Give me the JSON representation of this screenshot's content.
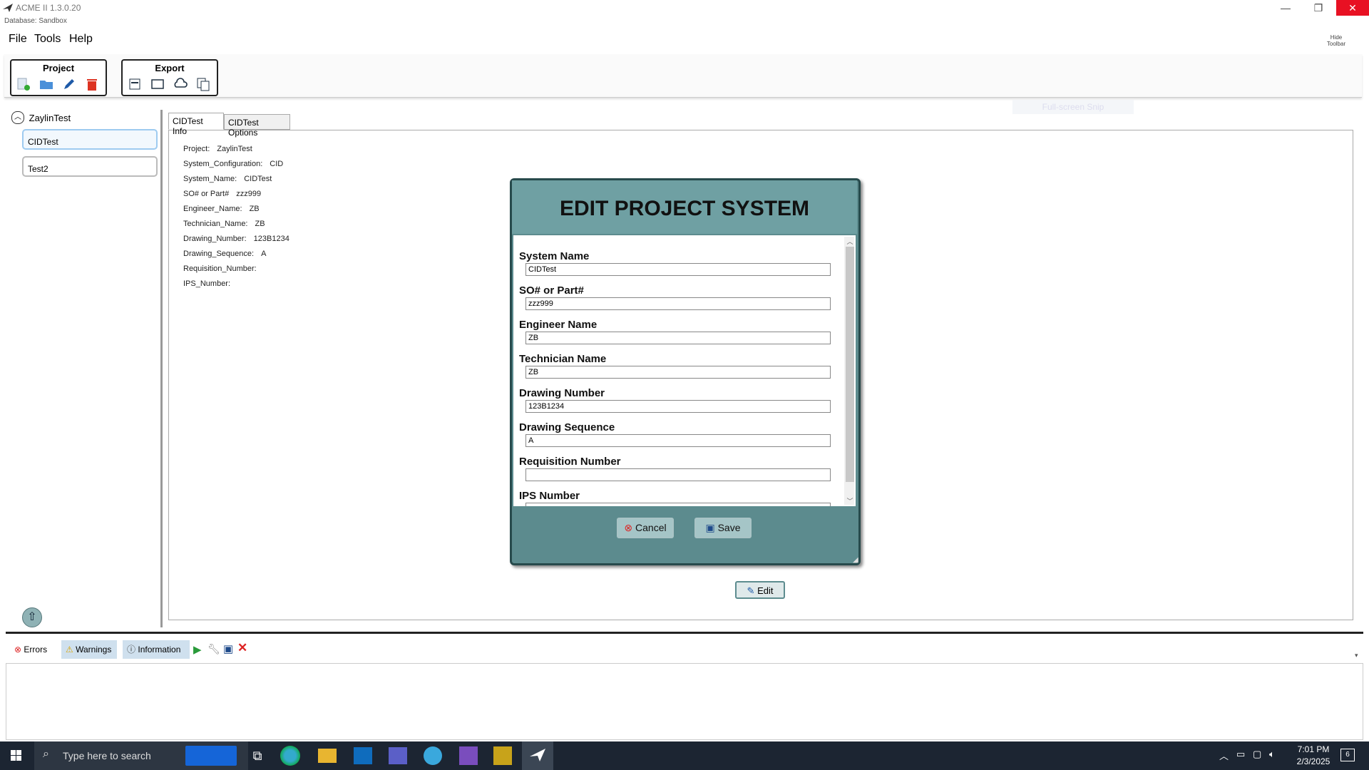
{
  "window": {
    "title": "ACME II 1.3.0.20",
    "database_label": "Database: Sandbox",
    "minimize": "—",
    "restore": "❐",
    "close": "✕"
  },
  "menu": {
    "file": "File",
    "tools": "Tools",
    "help": "Help",
    "hide_toolbar": "Hide Toolbar"
  },
  "toolbar": {
    "project_group": "Project",
    "export_group": "Export"
  },
  "tree": {
    "root": "ZaylinTest",
    "items": [
      "CIDTest",
      "Test2"
    ]
  },
  "tabs": {
    "info": "CIDTest Info",
    "options": "CIDTest Options"
  },
  "info": [
    {
      "label": "Project:",
      "value": "ZaylinTest"
    },
    {
      "label": "System_Configuration:",
      "value": "CID"
    },
    {
      "label": "System_Name:",
      "value": "CIDTest"
    },
    {
      "label": "SO# or Part#",
      "value": "zzz999"
    },
    {
      "label": "Engineer_Name:",
      "value": "ZB"
    },
    {
      "label": "Technician_Name:",
      "value": "ZB"
    },
    {
      "label": "Drawing_Number:",
      "value": "123B1234"
    },
    {
      "label": "Drawing_Sequence:",
      "value": "A"
    },
    {
      "label": "Requisition_Number:",
      "value": ""
    },
    {
      "label": "IPS_Number:",
      "value": ""
    }
  ],
  "ghost_text": "Full-screen Snip",
  "edit_button": "Edit",
  "modal": {
    "title": "EDIT PROJECT SYSTEM",
    "fields": [
      {
        "label": "System Name",
        "value": "CIDTest"
      },
      {
        "label": "SO# or Part#",
        "value": "zzz999"
      },
      {
        "label": "Engineer Name",
        "value": "ZB"
      },
      {
        "label": "Technician Name",
        "value": "ZB"
      },
      {
        "label": "Drawing Number",
        "value": "123B1234"
      },
      {
        "label": "Drawing Sequence",
        "value": "A"
      },
      {
        "label": "Requisition Number",
        "value": ""
      },
      {
        "label": "IPS Number",
        "value": ""
      }
    ],
    "cancel": "Cancel",
    "save": "Save"
  },
  "bottom": {
    "errors": "Errors",
    "warnings": "Warnings",
    "information": "Information"
  },
  "taskbar": {
    "search_placeholder": "Type here to search",
    "time": "7:01 PM",
    "date": "2/3/2025",
    "notifications": "6"
  },
  "colors": {
    "modal_bg": "#5c8b8e",
    "modal_header": "#6fa0a3",
    "close_red": "#e81123",
    "taskbar": "#1c2532"
  }
}
